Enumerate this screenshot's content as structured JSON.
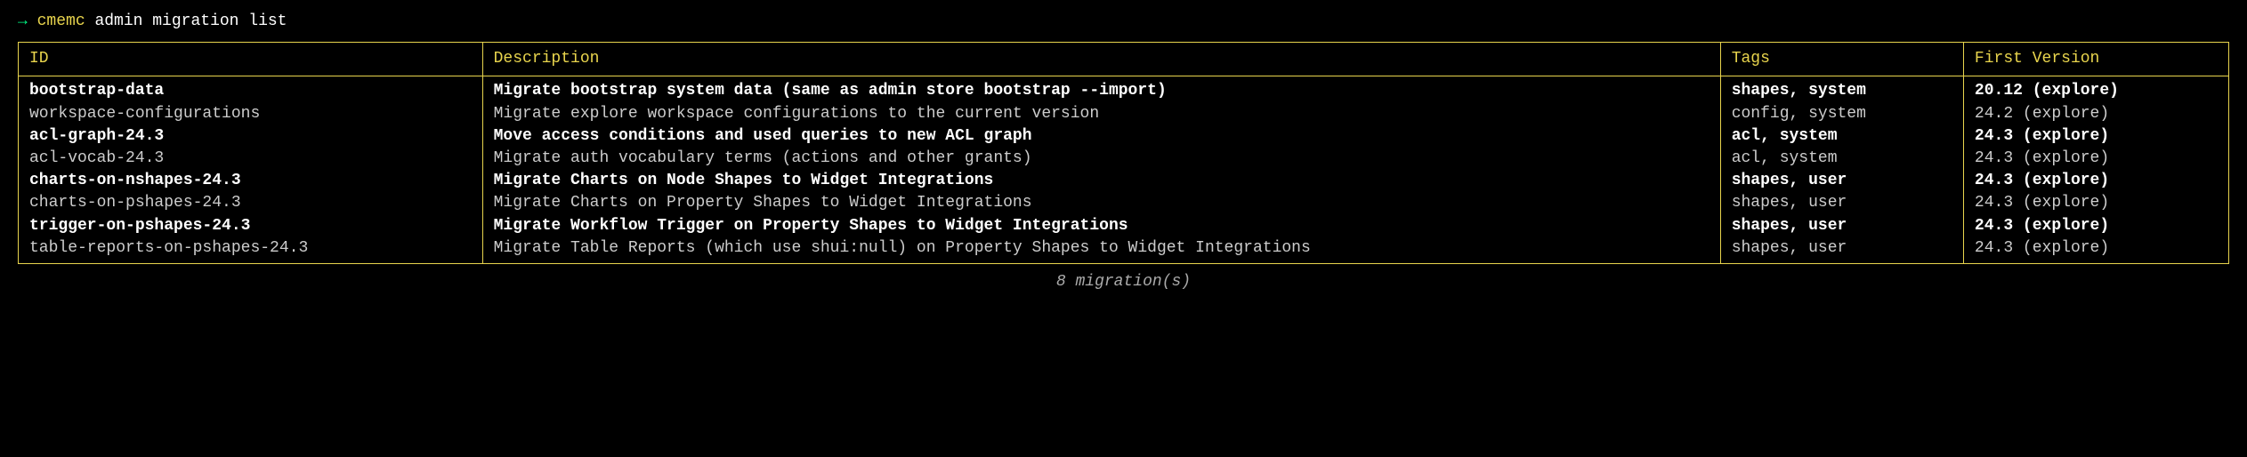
{
  "prompt": {
    "arrow": "→",
    "accent": "cmemc",
    "rest": " admin migration list"
  },
  "headers": {
    "id": "ID",
    "description": "Description",
    "tags": "Tags",
    "first_version": "First Version"
  },
  "rows": [
    {
      "bold": true,
      "id": "bootstrap-data",
      "description": "Migrate bootstrap system data (same as admin store bootstrap --import)",
      "tags": "shapes, system",
      "first_version": "20.12 (explore)"
    },
    {
      "bold": false,
      "id": "workspace-configurations",
      "description": "Migrate explore workspace configurations to the current version",
      "tags": "config, system",
      "first_version": "24.2 (explore)"
    },
    {
      "bold": true,
      "id": "acl-graph-24.3",
      "description": "Move access conditions and used queries to new ACL graph",
      "tags": "acl, system",
      "first_version": "24.3 (explore)"
    },
    {
      "bold": false,
      "id": "acl-vocab-24.3",
      "description": "Migrate auth vocabulary terms (actions and other grants)",
      "tags": "acl, system",
      "first_version": "24.3 (explore)"
    },
    {
      "bold": true,
      "id": "charts-on-nshapes-24.3",
      "description": "Migrate Charts on Node Shapes to Widget Integrations",
      "tags": "shapes, user",
      "first_version": "24.3 (explore)"
    },
    {
      "bold": false,
      "id": "charts-on-pshapes-24.3",
      "description": "Migrate Charts on Property Shapes to Widget Integrations",
      "tags": "shapes, user",
      "first_version": "24.3 (explore)"
    },
    {
      "bold": true,
      "id": "trigger-on-pshapes-24.3",
      "description": "Migrate Workflow Trigger on Property Shapes to Widget Integrations",
      "tags": "shapes, user",
      "first_version": "24.3 (explore)"
    },
    {
      "bold": false,
      "id": "table-reports-on-pshapes-24.3",
      "description": "Migrate Table Reports (which use shui:null) on Property Shapes to Widget Integrations",
      "tags": "shapes, user",
      "first_version": "24.3 (explore)"
    }
  ],
  "summary": "8 migration(s)"
}
